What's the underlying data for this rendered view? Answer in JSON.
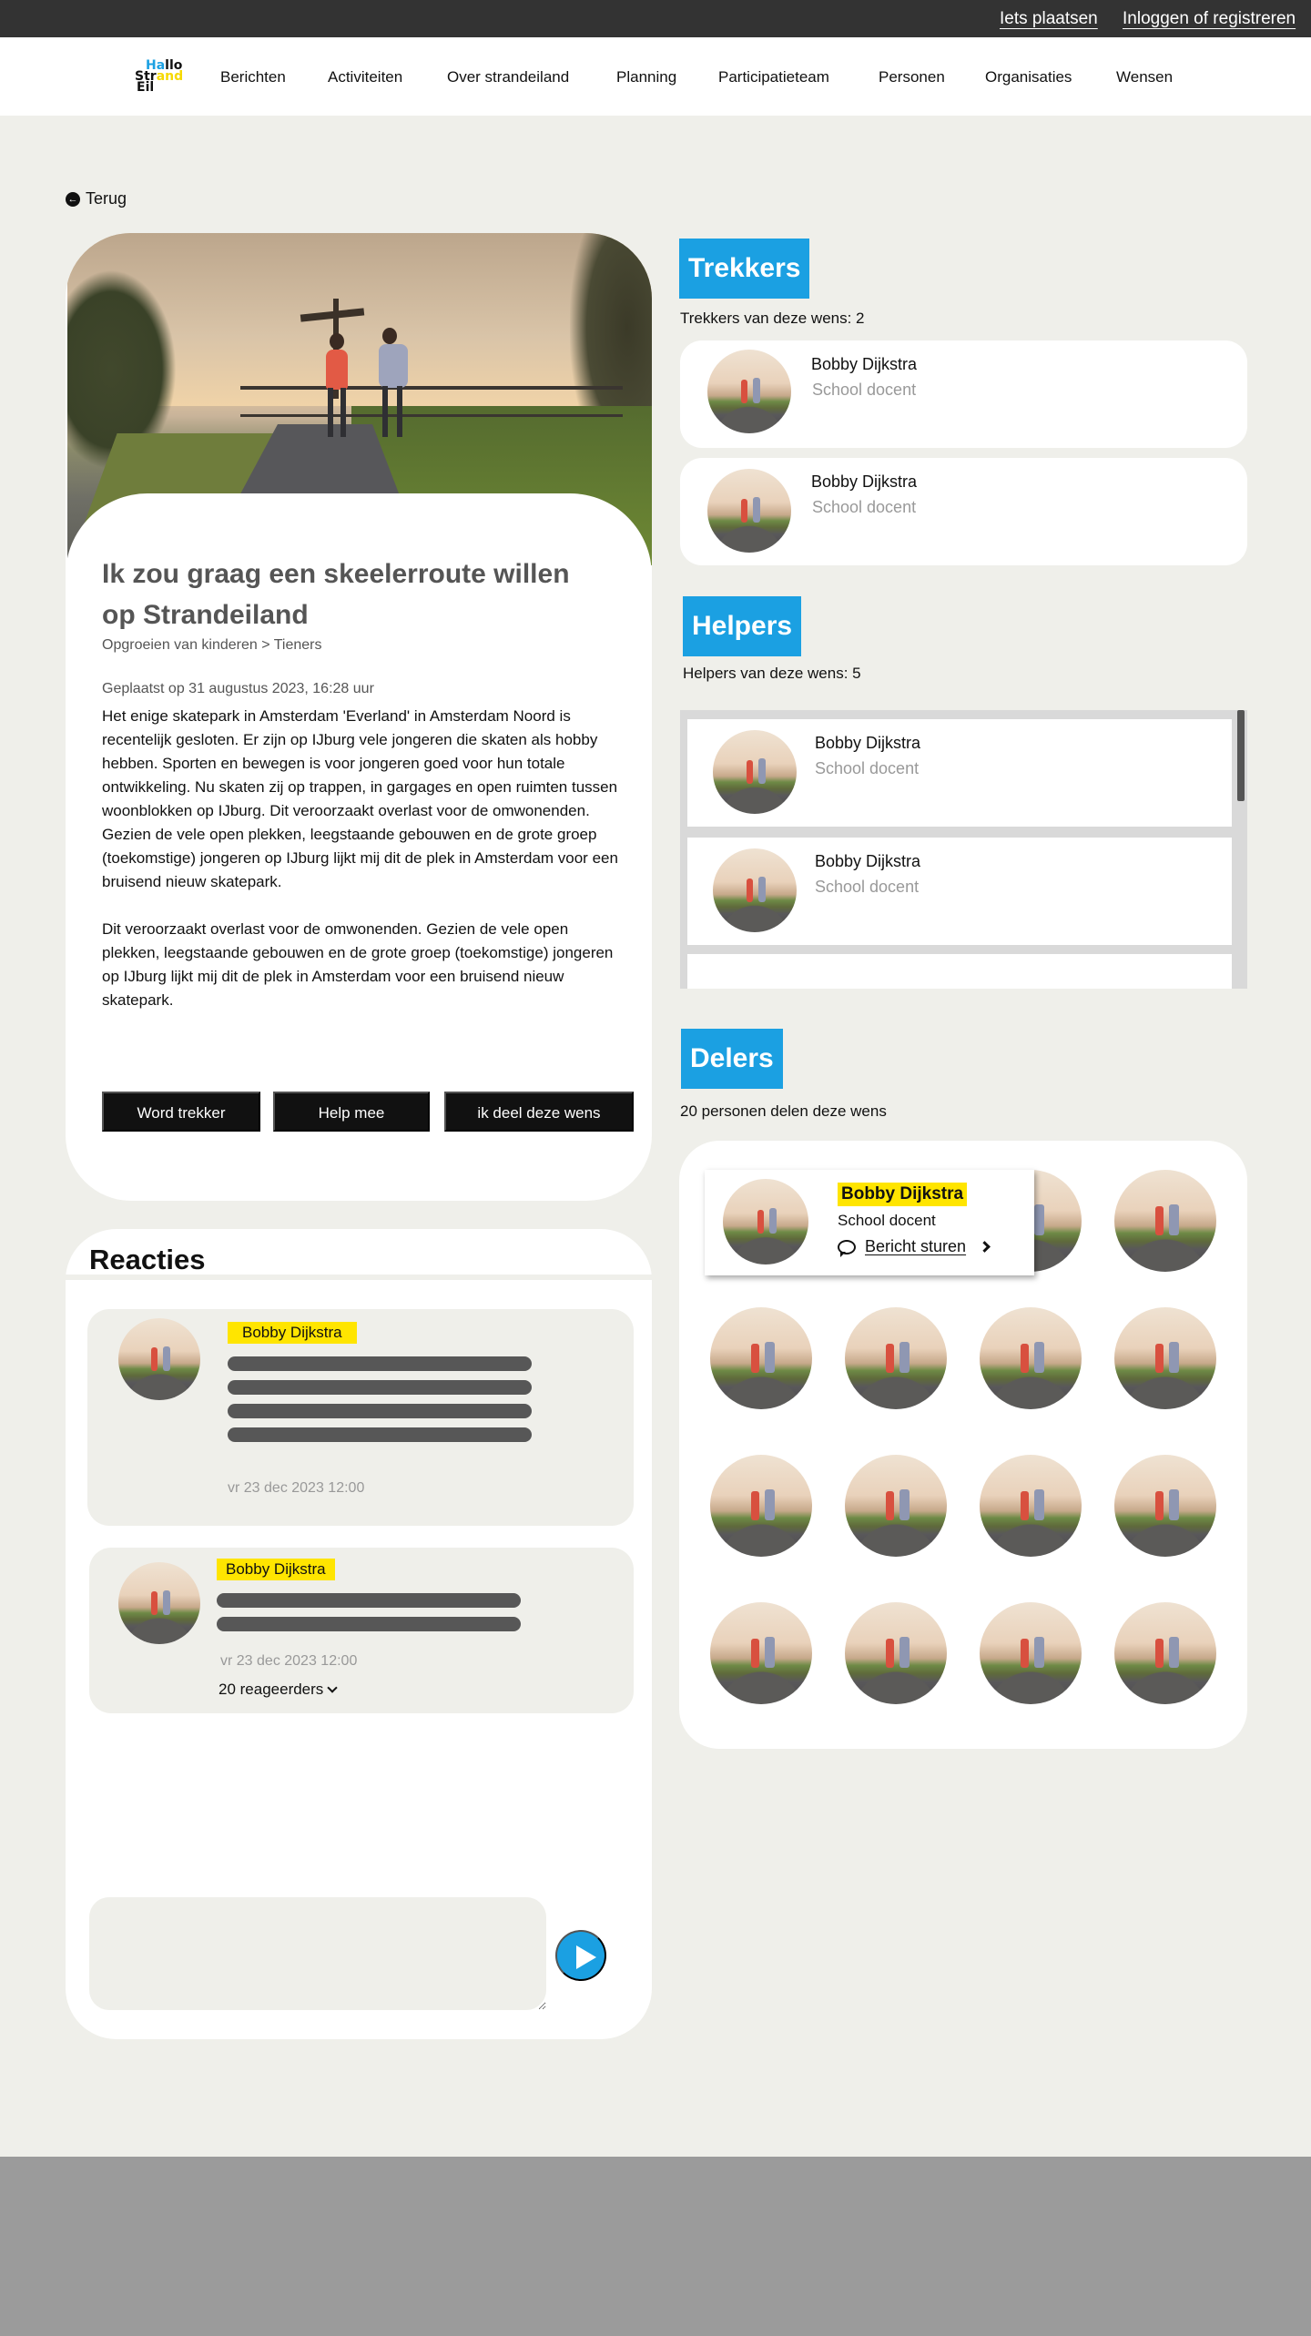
{
  "topbar": {
    "post_link": "Iets plaatsen",
    "login_link": "Inloggen of registreren"
  },
  "logo": {
    "line1_a": "Ha",
    "line1_b": "llo",
    "line2_a": "Str",
    "line2_b": "and",
    "line3": "Eil"
  },
  "nav": [
    "Berichten",
    "Activiteiten",
    "Over strandeiland",
    "Planning",
    "Participatieteam",
    "Personen",
    "Organisaties",
    "Wensen"
  ],
  "back": {
    "label": "Terug"
  },
  "wish": {
    "title": "Ik zou graag een skeelerroute willen op Strandeiland",
    "breadcrumb": "Opgroeien van kinderen > Tieners",
    "posted": "Geplaatst op 31 augustus 2023, 16:28 uur",
    "paragraph1": "Het enige skatepark in Amsterdam 'Everland' in Amsterdam Noord is recentelijk gesloten. Er zijn op IJburg vele jongeren die skaten als hobby hebben. Sporten en bewegen is voor jongeren goed voor hun totale ontwikkeling. Nu skaten zij op trappen, in gargages en open ruimten tussen woonblokken op IJburg. Dit veroorzaakt overlast voor de omwonenden. Gezien de vele open plekken, leegstaande gebouwen en de grote groep (toekomstige) jongeren op IJburg lijkt mij dit de plek in Amsterdam voor een bruisend nieuw skatepark.",
    "paragraph2": "Dit veroorzaakt overlast voor de omwonenden. Gezien de vele open plekken, leegstaande gebouwen en de grote groep (toekomstige) jongeren op IJburg lijkt mij dit de plek in Amsterdam voor een bruisend nieuw skatepark.",
    "buttons": {
      "trekker": "Word trekker",
      "help": "Help mee",
      "share": "ik deel deze wens"
    }
  },
  "reactions": {
    "title": "Reacties",
    "comments": [
      {
        "name": "Bobby Dijkstra",
        "timestamp": "vr 23 dec 2023 12:00"
      },
      {
        "name": "Bobby Dijkstra",
        "timestamp": "vr 23 dec 2023 12:00",
        "replies": "20 reageerders"
      }
    ]
  },
  "trekkers": {
    "tag": "Trekkers",
    "count_text": "Trekkers van deze wens: 2",
    "people": [
      {
        "name": "Bobby Dijkstra",
        "role": "School docent"
      },
      {
        "name": "Bobby Dijkstra",
        "role": "School docent"
      }
    ]
  },
  "helpers": {
    "tag": "Helpers",
    "count_text": "Helpers van deze wens: 5",
    "people": [
      {
        "name": "Bobby Dijkstra",
        "role": "School docent"
      },
      {
        "name": "Bobby Dijkstra",
        "role": "School docent"
      }
    ]
  },
  "sharers": {
    "tag": "Delers",
    "count_text": "20 personen delen deze wens",
    "popup": {
      "name": "Bobby Dijkstra",
      "role": "School docent",
      "action": "Bericht sturen"
    }
  },
  "colors": {
    "accent_blue": "#1ba0e2",
    "highlight_yellow": "#ffe500",
    "background": "#efefea",
    "dark": "#111111"
  }
}
